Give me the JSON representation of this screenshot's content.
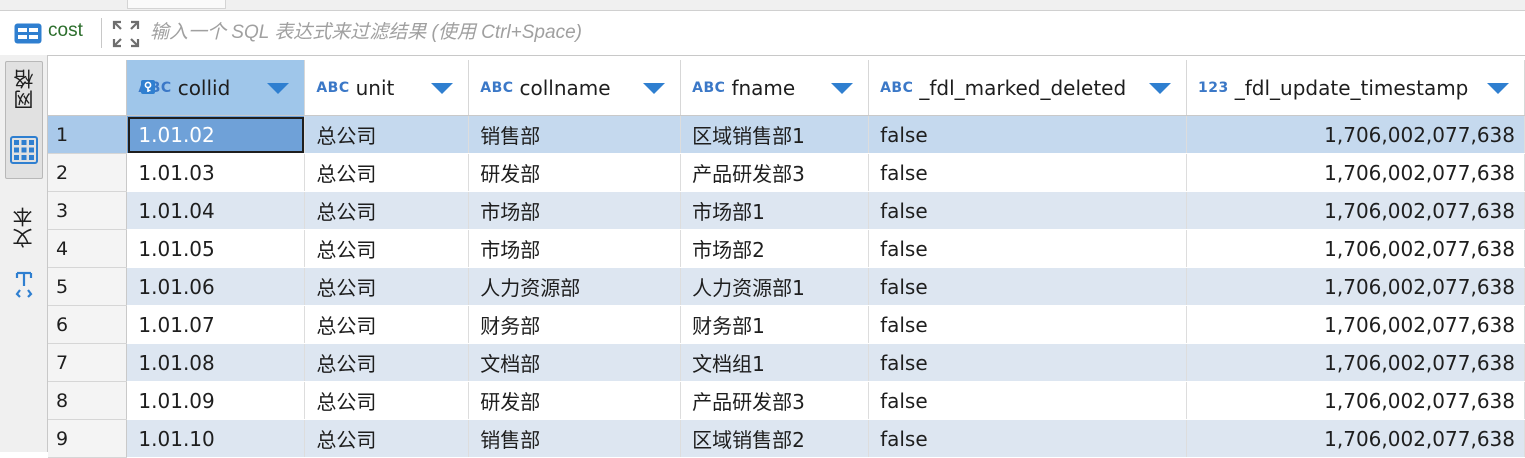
{
  "filter_bar": {
    "table_name": "cost",
    "table_icon": "table-icon",
    "expand_icon": "expand-icon",
    "filter_placeholder": "输入一个 SQL 表达式来过滤结果 (使用 Ctrl+Space)"
  },
  "left_panel": {
    "grid_tab_label": "网格",
    "grid_tab_icon": "grid-icon",
    "text_tab_label": "文本",
    "text_tab_icon": "text-icon"
  },
  "columns": [
    {
      "type": "ABC",
      "name": "collid",
      "primary_key": true
    },
    {
      "type": "ABC",
      "name": "unit"
    },
    {
      "type": "ABC",
      "name": "collname"
    },
    {
      "type": "ABC",
      "name": "fname"
    },
    {
      "type": "ABC",
      "name": "_fdl_marked_deleted"
    },
    {
      "type": "123",
      "name": "_fdl_update_timestamp"
    }
  ],
  "rows": [
    {
      "n": "1",
      "collid": "1.01.02",
      "unit": "总公司",
      "collname": "销售部",
      "fname": "区域销售部1",
      "deleted": "false",
      "ts": "1,706,002,077,638"
    },
    {
      "n": "2",
      "collid": "1.01.03",
      "unit": "总公司",
      "collname": "研发部",
      "fname": "产品研发部3",
      "deleted": "false",
      "ts": "1,706,002,077,638"
    },
    {
      "n": "3",
      "collid": "1.01.04",
      "unit": "总公司",
      "collname": "市场部",
      "fname": "市场部1",
      "deleted": "false",
      "ts": "1,706,002,077,638"
    },
    {
      "n": "4",
      "collid": "1.01.05",
      "unit": "总公司",
      "collname": "市场部",
      "fname": "市场部2",
      "deleted": "false",
      "ts": "1,706,002,077,638"
    },
    {
      "n": "5",
      "collid": "1.01.06",
      "unit": "总公司",
      "collname": "人力资源部",
      "fname": "人力资源部1",
      "deleted": "false",
      "ts": "1,706,002,077,638"
    },
    {
      "n": "6",
      "collid": "1.01.07",
      "unit": "总公司",
      "collname": "财务部",
      "fname": "财务部1",
      "deleted": "false",
      "ts": "1,706,002,077,638"
    },
    {
      "n": "7",
      "collid": "1.01.08",
      "unit": "总公司",
      "collname": "文档部",
      "fname": "文档组1",
      "deleted": "false",
      "ts": "1,706,002,077,638"
    },
    {
      "n": "8",
      "collid": "1.01.09",
      "unit": "总公司",
      "collname": "研发部",
      "fname": "产品研发部3",
      "deleted": "false",
      "ts": "1,706,002,077,638"
    },
    {
      "n": "9",
      "collid": "1.01.10",
      "unit": "总公司",
      "collname": "销售部",
      "fname": "区域销售部2",
      "deleted": "false",
      "ts": "1,706,002,077,638"
    }
  ],
  "selection": {
    "row": 1,
    "column": "collid"
  },
  "colors": {
    "accent": "#2f7fd0",
    "selected_header": "#9fc6ea",
    "row_stripe": "#dde6f1",
    "active_cell": "#6fa1d8",
    "table_name": "#2c6e2c"
  }
}
